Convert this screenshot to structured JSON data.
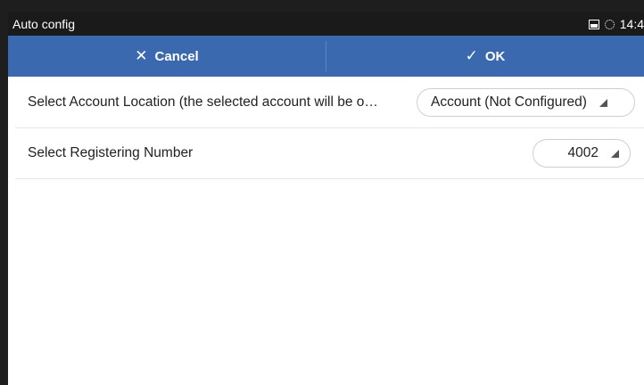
{
  "statusbar": {
    "title": "Auto config",
    "time": "14:4"
  },
  "actionbar": {
    "cancel_label": "Cancel",
    "ok_label": "OK"
  },
  "rows": [
    {
      "label": "Select Account Location (the selected account will be o…",
      "value": "Account (Not Configured)"
    },
    {
      "label": "Select Registering Number",
      "value": "4002"
    }
  ],
  "colors": {
    "accent": "#3a69b0",
    "statusbar": "#1a1a1a"
  }
}
